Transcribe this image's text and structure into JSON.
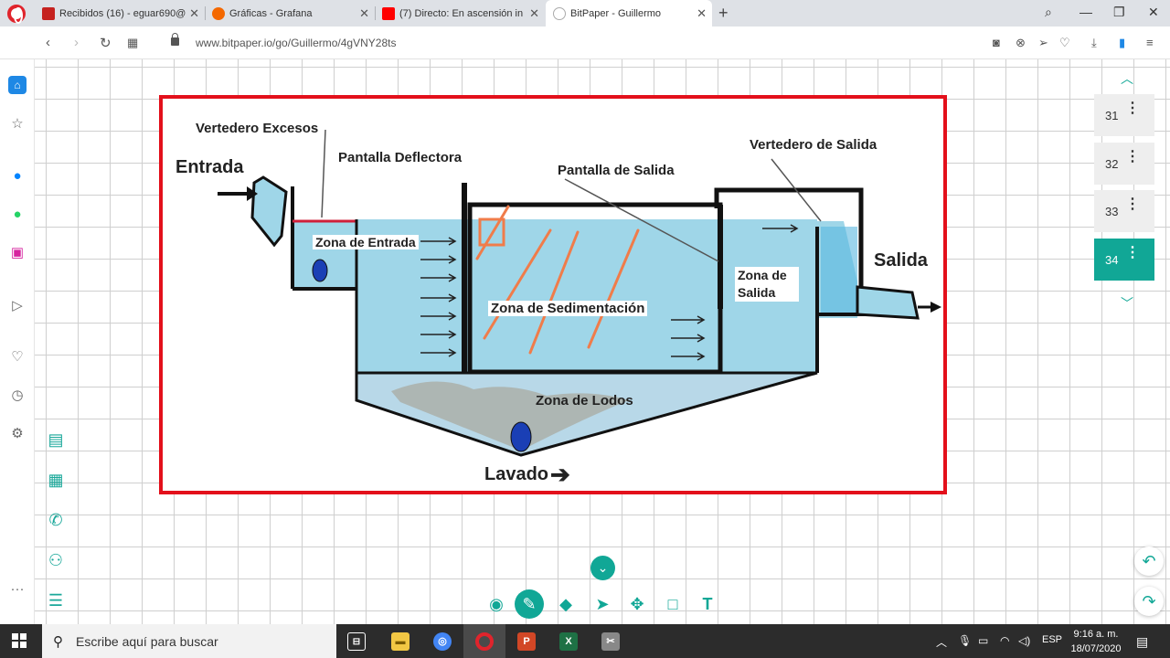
{
  "browser": {
    "tabs": [
      {
        "title": "Recibidos (16) - eguar690@",
        "favicon_color": "#c5221f"
      },
      {
        "title": "Gráficas - Grafana",
        "favicon_color": "#f46800"
      },
      {
        "title": "(7) Directo: En ascensión in",
        "favicon_color": "#ff0000"
      },
      {
        "title": "BitPaper - Guillermo",
        "favicon_color": "#bbbbbb"
      }
    ],
    "url": "www.bitpaper.io/go/Guillermo/4gVNY28ts"
  },
  "diagram": {
    "labels": {
      "entrada": "Entrada",
      "vertedero_excesos": "Vertedero Excesos",
      "pantalla_deflectora": "Pantalla Deflectora",
      "pantalla_salida": "Pantalla de Salida",
      "vertedero_salida": "Vertedero de Salida",
      "salida": "Salida",
      "zona_entrada": "Zona de Entrada",
      "zona_sedimentacion": "Zona de Sedimentación",
      "zona_salida": "Zona de Salida",
      "zona_lodos": "Zona de Lodos",
      "lavado": "Lavado"
    },
    "colors": {
      "water": "#9fd6e8",
      "annotation": "#f07c4a",
      "frame": "#e3101b"
    }
  },
  "pages": [
    {
      "num": "31",
      "active": false
    },
    {
      "num": "32",
      "active": false
    },
    {
      "num": "33",
      "active": false
    },
    {
      "num": "34",
      "active": true
    }
  ],
  "taskbar": {
    "search_placeholder": "Escribe aquí para buscar",
    "language": "ESP",
    "time": "9:16 a. m.",
    "date": "18/07/2020"
  },
  "accent": "#11a796"
}
